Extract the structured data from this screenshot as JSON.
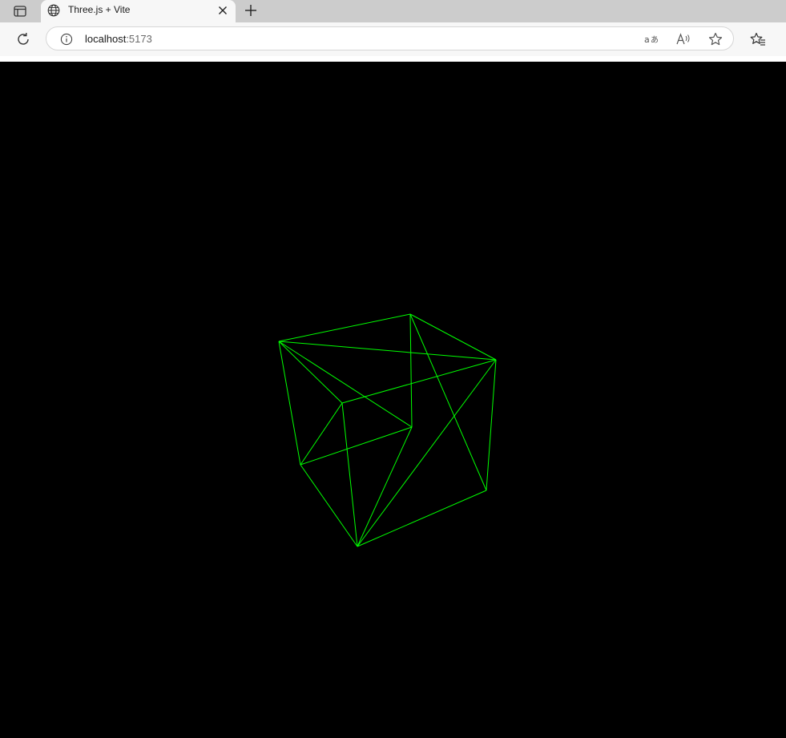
{
  "tab": {
    "title": "Three.js + Vite"
  },
  "address": {
    "host": "localhost",
    "port": ":5173"
  },
  "icons": {
    "tab_actions": "tab-actions-icon",
    "favicon": "globe-icon",
    "close": "close-icon",
    "new_tab": "plus-icon",
    "refresh": "refresh-icon",
    "site_info": "info-icon",
    "translate": "translate-icon",
    "read_aloud": "read-aloud-icon",
    "favorite": "star-icon",
    "favorites_menu": "favorites-icon"
  },
  "colors": {
    "wireframe": "#00ff00",
    "background": "#000000"
  },
  "scene": {
    "object": "cube",
    "render": "wireframe"
  }
}
